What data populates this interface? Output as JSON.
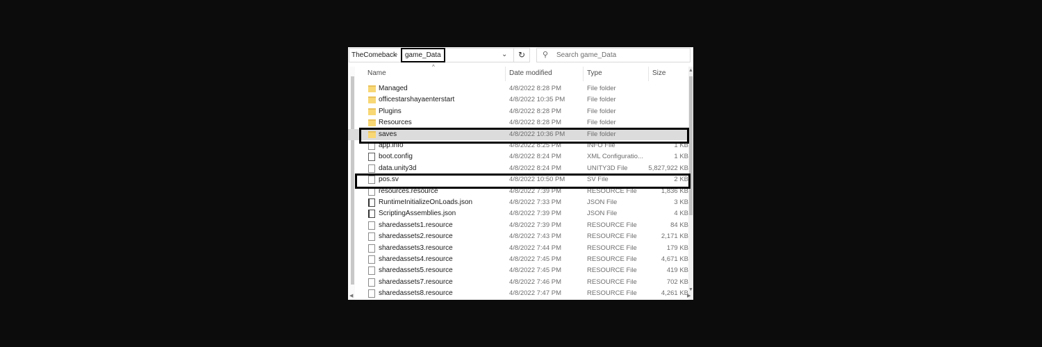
{
  "address_bar": {
    "root_crumb": "TheComeback",
    "separator": "›",
    "current_crumb": "game_Data",
    "dropdown_icon": "⌄",
    "refresh_icon": "↻"
  },
  "search": {
    "icon": "⚲",
    "placeholder": "Search game_Data"
  },
  "columns": {
    "name": "Name",
    "date": "Date modified",
    "type": "Type",
    "size": "Size",
    "sort_indicator": "^"
  },
  "files": [
    {
      "name": "Managed",
      "date": "4/8/2022 8:28 PM",
      "type": "File folder",
      "size": "",
      "icon": "folder-icon"
    },
    {
      "name": "officestarshayaenterstart",
      "date": "4/8/2022 10:35 PM",
      "type": "File folder",
      "size": "",
      "icon": "folder-icon"
    },
    {
      "name": "Plugins",
      "date": "4/8/2022 8:28 PM",
      "type": "File folder",
      "size": "",
      "icon": "folder-icon"
    },
    {
      "name": "Resources",
      "date": "4/8/2022 8:28 PM",
      "type": "File folder",
      "size": "",
      "icon": "folder-icon"
    },
    {
      "name": "saves",
      "date": "4/8/2022 10:36 PM",
      "type": "File folder",
      "size": "",
      "icon": "folder-icon",
      "selected": true
    },
    {
      "name": "app.info",
      "date": "4/8/2022 8:25 PM",
      "type": "INFO File",
      "size": "1 KB",
      "icon": "file-icon"
    },
    {
      "name": "boot.config",
      "date": "4/8/2022 8:24 PM",
      "type": "XML Configuratio...",
      "size": "1 KB",
      "icon": "config-file-icon"
    },
    {
      "name": "data.unity3d",
      "date": "4/8/2022 8:24 PM",
      "type": "UNITY3D File",
      "size": "5,827,922 KB",
      "icon": "file-icon"
    },
    {
      "name": "pos.sv",
      "date": "4/8/2022 10:50 PM",
      "type": "SV File",
      "size": "2 KB",
      "icon": "file-icon"
    },
    {
      "name": "resources.resource",
      "date": "4/8/2022 7:39 PM",
      "type": "RESOURCE File",
      "size": "1,836 KB",
      "icon": "file-icon"
    },
    {
      "name": "RuntimeInitializeOnLoads.json",
      "date": "4/8/2022 7:33 PM",
      "type": "JSON File",
      "size": "3 KB",
      "icon": "script-file-icon"
    },
    {
      "name": "ScriptingAssemblies.json",
      "date": "4/8/2022 7:39 PM",
      "type": "JSON File",
      "size": "4 KB",
      "icon": "script-file-icon"
    },
    {
      "name": "sharedassets1.resource",
      "date": "4/8/2022 7:39 PM",
      "type": "RESOURCE File",
      "size": "84 KB",
      "icon": "file-icon"
    },
    {
      "name": "sharedassets2.resource",
      "date": "4/8/2022 7:43 PM",
      "type": "RESOURCE File",
      "size": "2,171 KB",
      "icon": "file-icon"
    },
    {
      "name": "sharedassets3.resource",
      "date": "4/8/2022 7:44 PM",
      "type": "RESOURCE File",
      "size": "179 KB",
      "icon": "file-icon"
    },
    {
      "name": "sharedassets4.resource",
      "date": "4/8/2022 7:45 PM",
      "type": "RESOURCE File",
      "size": "4,671 KB",
      "icon": "file-icon"
    },
    {
      "name": "sharedassets5.resource",
      "date": "4/8/2022 7:45 PM",
      "type": "RESOURCE File",
      "size": "419 KB",
      "icon": "file-icon"
    },
    {
      "name": "sharedassets7.resource",
      "date": "4/8/2022 7:46 PM",
      "type": "RESOURCE File",
      "size": "702 KB",
      "icon": "file-icon"
    },
    {
      "name": "sharedassets8.resource",
      "date": "4/8/2022 7:47 PM",
      "type": "RESOURCE File",
      "size": "4,261 KB",
      "icon": "file-icon"
    }
  ],
  "scrollbars": {
    "up_arrow": "▲",
    "down_arrow": "▼",
    "left_arrow": "◀",
    "right_arrow": "▶"
  },
  "colors": {
    "background": "#0c0c0c",
    "window": "#ffffff",
    "selected_row": "#dcdcdc",
    "folder": "#f8d775",
    "highlight_box": "#000000"
  }
}
